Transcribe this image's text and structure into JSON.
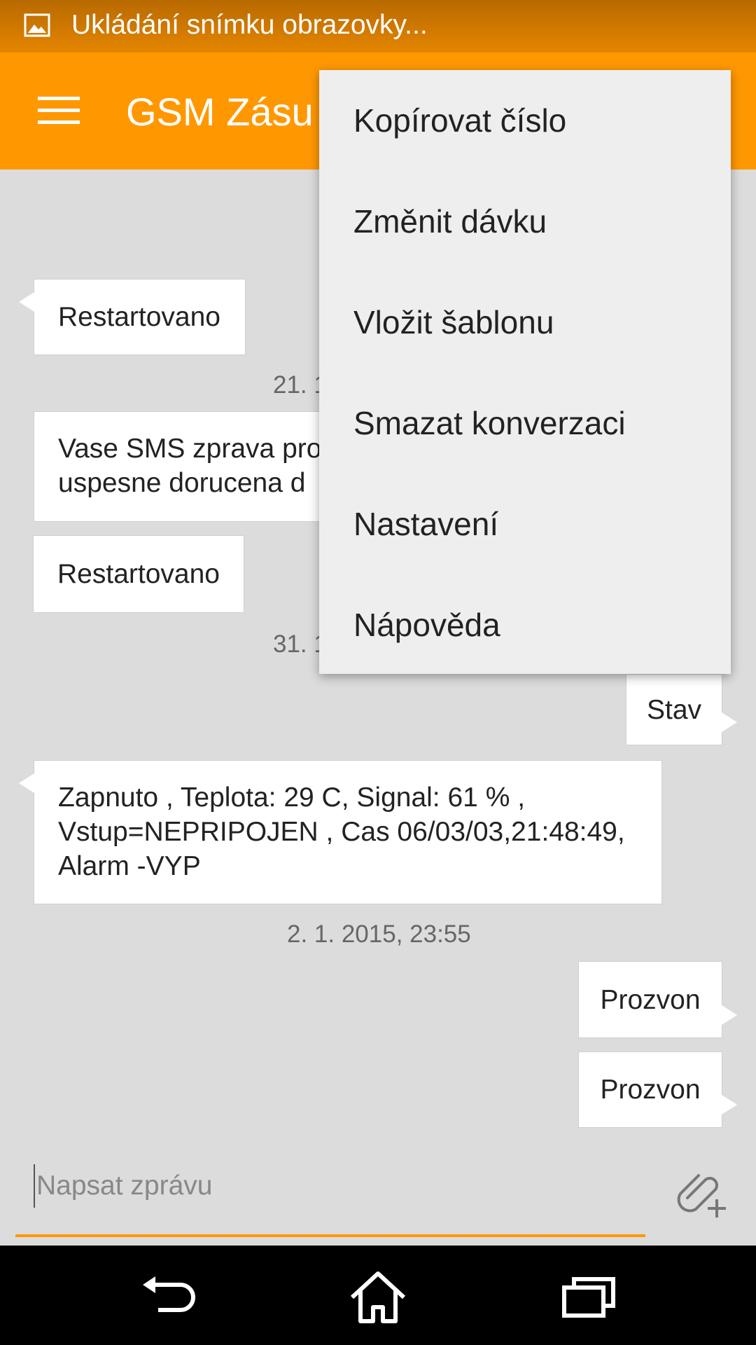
{
  "status_bar": {
    "notification_text": "Ukládání snímku obrazovky...",
    "icon": "image-icon"
  },
  "app_bar": {
    "title": "GSM Zásu",
    "menu_icon": "hamburger-menu-icon",
    "background": "#ff9800"
  },
  "messages": [
    {
      "direction": "incoming",
      "text": "Restartovano"
    },
    {
      "timestamp": "21. 1"
    },
    {
      "direction": "incoming",
      "lines": [
        "Vase SMS zprava pro",
        "uspesne dorucena d"
      ]
    },
    {
      "direction": "incoming",
      "text": "Restartovano"
    },
    {
      "timestamp": "31. 1"
    },
    {
      "direction": "outgoing",
      "text": "Stav"
    },
    {
      "direction": "incoming",
      "lines": [
        "Zapnuto , Teplota: 29 C, Signal: 61 % ,",
        "Vstup=NEPRIPOJEN , Cas 06/03/03,21:48:49,",
        "Alarm -VYP"
      ]
    },
    {
      "timestamp": "2. 1. 2015, 23:55"
    },
    {
      "direction": "outgoing",
      "text": "Prozvon"
    },
    {
      "direction": "outgoing",
      "text": "Prozvon"
    }
  ],
  "overflow_menu": {
    "items": [
      "Kopírovat číslo",
      "Změnit dávku",
      "Vložit šablonu",
      "Smazat konverzaci",
      "Nastavení",
      "Nápověda"
    ]
  },
  "compose": {
    "placeholder": "Napsat zprávu",
    "value": "",
    "attach_icon": "attach-add-icon",
    "accent": "#ff9800"
  },
  "nav_bar": {
    "icons": [
      "back-icon",
      "home-icon",
      "recent-apps-icon"
    ]
  }
}
